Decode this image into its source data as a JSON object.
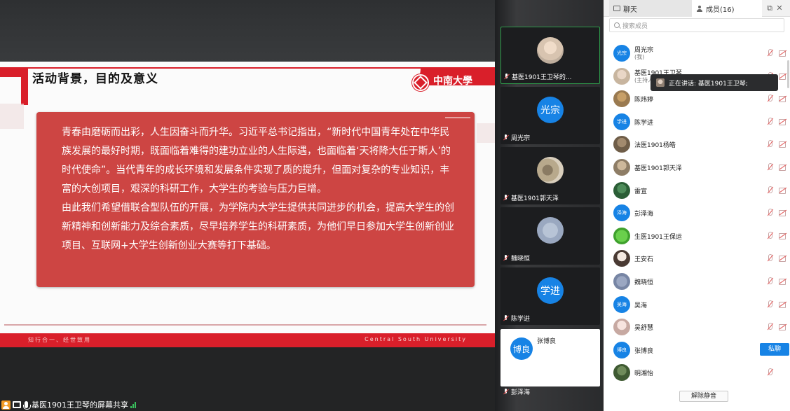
{
  "slide": {
    "title": "活动背景，目的及意义",
    "logo_text": "中南大學",
    "logo_sub": "CENTRAL SOUTH UNIVERSITY",
    "body_p1": "青春由磨砺而出彩，人生因奋斗而升华。习近平总书记指出，“新时代中国青年处在中华民族发展的最好时期，既面临着难得的建功立业的人生际遇，也面临着‘天将降大任于斯人’的时代使命”。当代青年的成长环境和发展条件实现了质的提升，但面对复杂的专业知识，丰富的大创项目，艰深的科研工作，大学生的考验与压力巨增。",
    "body_p2": "由此我们希望借联合型队伍的开展，为学院内大学生提供共同进步的机会，提高大学生的创新精神和创新能力及综合素质，尽早培养学生的科研素质，为他们早日参加大学生创新创业项目、互联网+大学生创新创业大赛等打下基础。",
    "footer_left": "知行合一、经世致用",
    "footer_right": "Central South University"
  },
  "share_status": "基医1901王卫琴的屏幕共享",
  "tiles": [
    {
      "name": "基医1901王卫琴的...",
      "avatar": "",
      "style": "photo1"
    },
    {
      "name": "周光宗",
      "avatar": "光宗",
      "style": "blue"
    },
    {
      "name": "基医1901郭天泽",
      "avatar": "",
      "style": "photo2"
    },
    {
      "name": "魏晓恒",
      "avatar": "",
      "style": "photo3"
    },
    {
      "name": "陈学进",
      "avatar": "学进",
      "style": "blue"
    },
    {
      "name": "彭泽海",
      "avatar": "博良",
      "side_name": "张博良",
      "style": "white"
    }
  ],
  "panel": {
    "tab_chat": "聊天",
    "tab_members": "成员(16)",
    "search_placeholder": "搜索成员",
    "speaking": "正在讲话: 基医1901王卫琴;",
    "mute_btn": "私聊",
    "unmute_all": "解除静音",
    "members": [
      {
        "name": "周光宗",
        "sub": "(我)",
        "avatar": "光宗",
        "style": "blue"
      },
      {
        "name": "基医1901王卫琴",
        "sub": "(主持人...",
        "avatar": "",
        "style": "p-a"
      },
      {
        "name": "陈炜婷",
        "sub": "",
        "avatar": "",
        "style": "p-b"
      },
      {
        "name": "陈学进",
        "sub": "",
        "avatar": "学进",
        "style": "blue"
      },
      {
        "name": "法医1901杨皓",
        "sub": "",
        "avatar": "",
        "style": "p-c"
      },
      {
        "name": "基医1901郭天泽",
        "sub": "",
        "avatar": "",
        "style": "p-d"
      },
      {
        "name": "雷宣",
        "sub": "",
        "avatar": "",
        "style": "p-e"
      },
      {
        "name": "彭泽海",
        "sub": "",
        "avatar": "泽海",
        "style": "blue"
      },
      {
        "name": "生医1901王保运",
        "sub": "",
        "avatar": "",
        "style": "p-f"
      },
      {
        "name": "王安石",
        "sub": "",
        "avatar": "",
        "style": "p-g"
      },
      {
        "name": "魏晓恒",
        "sub": "",
        "avatar": "",
        "style": "p-h"
      },
      {
        "name": "吴海",
        "sub": "",
        "avatar": "吴海",
        "style": "blue"
      },
      {
        "name": "吴舒慧",
        "sub": "",
        "avatar": "",
        "style": "p-i"
      },
      {
        "name": "张博良",
        "sub": "",
        "avatar": "博良",
        "style": "blue"
      },
      {
        "name": "明湘怡",
        "sub": "",
        "avatar": "",
        "style": "p-j"
      }
    ]
  },
  "colors": {
    "brand_red": "#d91f2a",
    "box_red": "#cd4543",
    "accent_blue": "#1783e5",
    "active_green": "#2e9c4a"
  }
}
